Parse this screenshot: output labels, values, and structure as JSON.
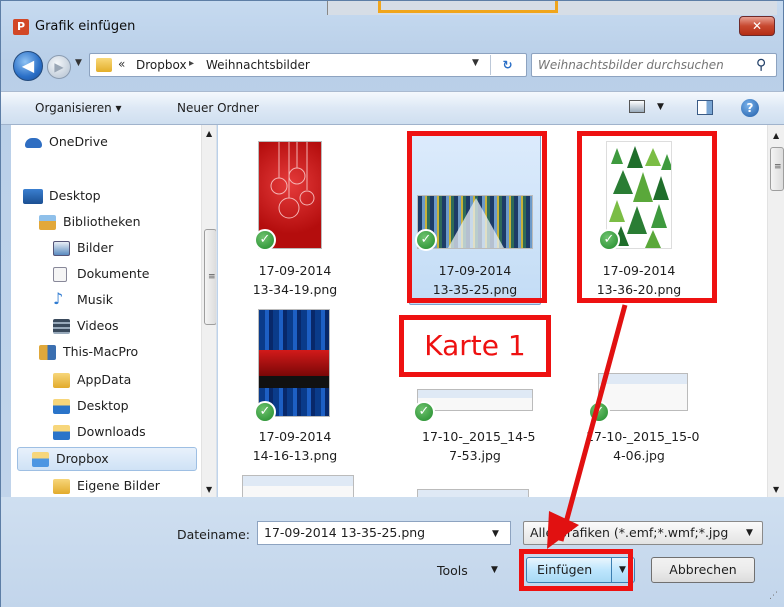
{
  "window": {
    "title": "Grafik einfügen",
    "close_glyph": "✕",
    "app_icon_letter": "P"
  },
  "address": {
    "back_glyph": "◀",
    "forward_glyph": "▶",
    "overflow_glyph": "«",
    "breadcrumbs": [
      "Dropbox",
      "Weihnachtsbilder"
    ],
    "separator": "▸",
    "refresh_glyph": "↻"
  },
  "search": {
    "placeholder": "Weihnachtsbilder durchsuchen",
    "icon": "search-icon",
    "glyph": "⚲"
  },
  "toolbar": {
    "organize_label": "Organisieren ▾",
    "new_folder_label": "Neuer Ordner",
    "help_glyph": "?"
  },
  "nav": {
    "items": [
      {
        "label": "OneDrive",
        "icon": "cloud-icon",
        "color": "#2f6ec2"
      },
      {
        "label": "Desktop",
        "icon": "desktop-icon",
        "color": "#1f5fa8"
      },
      {
        "label": "Bibliotheken",
        "icon": "libraries-icon",
        "color": "#e2a83a"
      },
      {
        "label": "Bilder",
        "icon": "pictures-icon",
        "color": "#5a8bc0"
      },
      {
        "label": "Dokumente",
        "icon": "documents-icon",
        "color": "#c8d2de"
      },
      {
        "label": "Musik",
        "icon": "music-icon",
        "color": "#2f7bd1"
      },
      {
        "label": "Videos",
        "icon": "videos-icon",
        "color": "#3a4a5c"
      },
      {
        "label": "This-MacPro",
        "icon": "user-folder-icon",
        "color": "#e0a83a"
      },
      {
        "label": "AppData",
        "icon": "folder-icon",
        "color": "#e9bb45"
      },
      {
        "label": "Desktop",
        "icon": "folder-icon",
        "color": "#2a74c9"
      },
      {
        "label": "Downloads",
        "icon": "downloads-icon",
        "color": "#2a74c9"
      },
      {
        "label": "Dropbox",
        "icon": "dropbox-icon",
        "color": "#4d96e2"
      },
      {
        "label": "Eigene Bilder",
        "icon": "folder-icon",
        "color": "#e9bb45"
      }
    ],
    "selected": "Dropbox"
  },
  "files": [
    {
      "name_line1": "17-09-2014",
      "name_line2": "13-34-19.png",
      "thumb": "red-ornaments"
    },
    {
      "name_line1": "17-09-2014",
      "name_line2": "13-35-25.png",
      "thumb": "mosaic-tree",
      "selected": true
    },
    {
      "name_line1": "17-09-2014",
      "name_line2": "13-36-20.png",
      "thumb": "green-trees"
    },
    {
      "name_line1": "17-09-2014",
      "name_line2": "14-16-13.png",
      "thumb": "blue-red-stripes"
    },
    {
      "name_line1": "17-10-_2015_14-5",
      "name_line2": "7-53.jpg",
      "thumb": "browser-screenshot"
    },
    {
      "name_line1": "17-10-_2015_15-0",
      "name_line2": "4-06.jpg",
      "thumb": "browser-screenshot"
    }
  ],
  "annotation": {
    "label": "Karte 1",
    "color": "#e11111"
  },
  "bottom": {
    "filename_label": "Dateiname:",
    "filename_value": "17-09-2014 13-35-25.png",
    "filetype_value": "Alle Grafiken (*.emf;*.wmf;*.jpg",
    "tools_label": "Tools",
    "insert_label": "Einfügen",
    "cancel_label": "Abbrechen"
  }
}
